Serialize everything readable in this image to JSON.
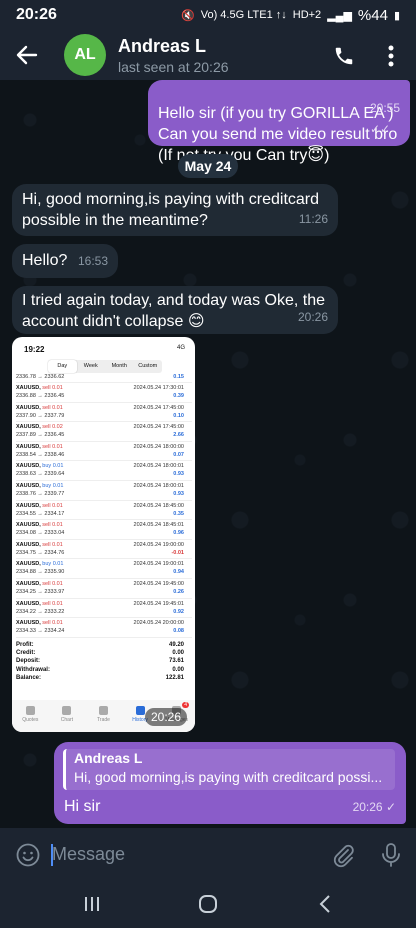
{
  "status_bar": {
    "time": "20:26",
    "network": "Vo) 4.5G LTE1 ↑↓",
    "signal": "HD+2",
    "battery": "%44"
  },
  "header": {
    "avatar_initials": "AL",
    "name": "Andreas L",
    "status": "last seen at 20:26"
  },
  "date_separator": "May 24",
  "messages": [
    {
      "type": "out",
      "text": "Hello sir (if you try GORILLA EA )\nCan you send me video result bro\n(If not try you Can try😇)",
      "time": "20:55",
      "status": "read"
    },
    {
      "type": "in",
      "text": "Hi, good morning,is paying with creditcard possible in the meantime?",
      "time": "11:26"
    },
    {
      "type": "in",
      "text": "Hello?",
      "time": "16:53"
    },
    {
      "type": "in",
      "text": "I tried again today, and today was Oke, the account didn't collapse 😊",
      "time": "20:26"
    },
    {
      "type": "in",
      "kind": "image",
      "time": "20:26"
    },
    {
      "type": "out",
      "reply_to": {
        "name": "Andreas L",
        "text": "Hi, good morning,is paying with creditcard possi..."
      },
      "text": "Hi sir",
      "time": "20:26",
      "status": "sent"
    }
  ],
  "screenshot": {
    "time": "19:22",
    "status": "4G",
    "tabs": [
      "Day",
      "Week",
      "Month",
      "Custom"
    ],
    "active_tab": "Day",
    "top_partial": {
      "prices": "2336.78 → 2336.62",
      "profit": "0.15"
    },
    "trades": [
      {
        "symbol": "XAUUSD,",
        "dir": "sell 0.01",
        "prices": "2336.88 → 2336.45",
        "date": "2024.05.24 17:30:01",
        "profit": "0.39"
      },
      {
        "symbol": "XAUUSD,",
        "dir": "sell 0.01",
        "prices": "2337.90 → 2337.79",
        "date": "2024.05.24 17:45:00",
        "profit": "0.10"
      },
      {
        "symbol": "XAUUSD,",
        "dir": "sell 0.02",
        "prices": "2337.89 → 2336.45",
        "date": "2024.05.24 17:45:00",
        "profit": "2.66"
      },
      {
        "symbol": "XAUUSD,",
        "dir": "sell 0.01",
        "prices": "2338.54 → 2338.46",
        "date": "2024.05.24 18:00:00",
        "profit": "0.07"
      },
      {
        "symbol": "XAUUSD,",
        "dir": "buy 0.01",
        "prices": "2338.63 → 2339.64",
        "date": "2024.05.24 18:00:01",
        "profit": "0.93"
      },
      {
        "symbol": "XAUUSD,",
        "dir": "buy 0.01",
        "prices": "2338.76 → 2339.77",
        "date": "2024.05.24 18:00:01",
        "profit": "0.93"
      },
      {
        "symbol": "XAUUSD,",
        "dir": "sell 0.01",
        "prices": "2334.55 → 2334.17",
        "date": "2024.05.24 18:45:00",
        "profit": "0.35"
      },
      {
        "symbol": "XAUUSD,",
        "dir": "sell 0.01",
        "prices": "2334.08 → 2333.04",
        "date": "2024.05.24 18:45:01",
        "profit": "0.96"
      },
      {
        "symbol": "XAUUSD,",
        "dir": "sell 0.01",
        "prices": "2334.75 → 2334.76",
        "date": "2024.05.24 19:00:00",
        "profit": "-0.01"
      },
      {
        "symbol": "XAUUSD,",
        "dir": "buy 0.01",
        "prices": "2334.88 → 2335.90",
        "date": "2024.05.24 19:00:01",
        "profit": "0.94"
      },
      {
        "symbol": "XAUUSD,",
        "dir": "sell 0.01",
        "prices": "2334.25 → 2333.97",
        "date": "2024.05.24 19:45:00",
        "profit": "0.26"
      },
      {
        "symbol": "XAUUSD,",
        "dir": "sell 0.01",
        "prices": "2334.22 → 2333.22",
        "date": "2024.05.24 19:45:01",
        "profit": "0.92"
      },
      {
        "symbol": "XAUUSD,",
        "dir": "sell 0.01",
        "prices": "2334.33 → 2334.24",
        "date": "2024.05.24 20:00:00",
        "profit": "0.08"
      }
    ],
    "summary": [
      {
        "label": "Profit:",
        "value": "49.20"
      },
      {
        "label": "Credit:",
        "value": "0.00"
      },
      {
        "label": "Deposit:",
        "value": "73.61"
      },
      {
        "label": "Withdrawal:",
        "value": "0.00"
      },
      {
        "label": "Balance:",
        "value": "122.81"
      }
    ],
    "nav": [
      "Quotes",
      "Chart",
      "Trade",
      "History",
      "Messages"
    ],
    "nav_badge": "4"
  },
  "input": {
    "placeholder": "Message"
  },
  "colors": {
    "outgoing": "#8a5cc9",
    "incoming": "#202a34",
    "header": "#1c2430",
    "accent": "#56b748",
    "buy": "#2a6cd8",
    "sell": "#d83a3a"
  }
}
